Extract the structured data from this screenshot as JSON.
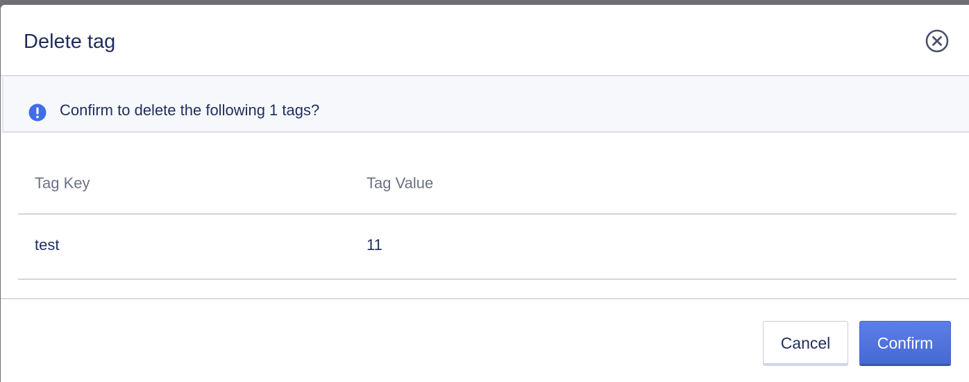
{
  "dialog": {
    "title": "Delete tag",
    "close_icon": "close-circle-icon"
  },
  "alert": {
    "icon": "info-exclamation-icon",
    "message": "Confirm to delete the following 1 tags?"
  },
  "table": {
    "columns": [
      "Tag Key",
      "Tag Value"
    ],
    "rows": [
      [
        "test",
        "11"
      ]
    ]
  },
  "footer": {
    "cancel_label": "Cancel",
    "confirm_label": "Confirm"
  },
  "colors": {
    "primary": "#4f73dd",
    "title_text": "#1f2d5c",
    "muted_text": "#6b7283",
    "alert_bg": "#f7f8fb"
  }
}
